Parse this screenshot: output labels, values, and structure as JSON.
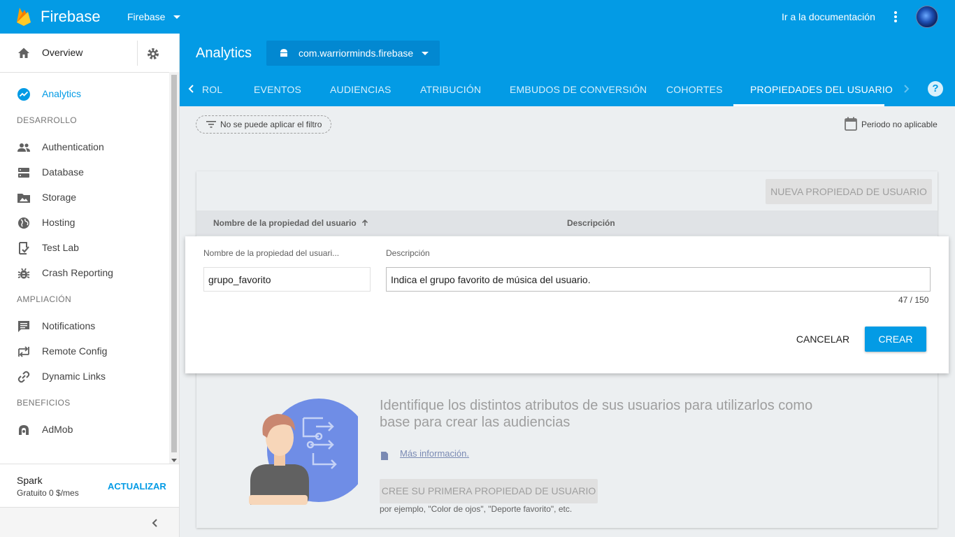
{
  "topbar": {
    "brand": "Firebase",
    "project": "Firebase",
    "docs_link": "Ir a la documentación"
  },
  "sidebar": {
    "overview": "Overview",
    "active_item": "Analytics",
    "sections": {
      "development": "DESARROLLO",
      "growth": "AMPLIACIÓN",
      "earn": "BENEFICIOS"
    },
    "items": {
      "analytics": "Analytics",
      "authentication": "Authentication",
      "database": "Database",
      "storage": "Storage",
      "hosting": "Hosting",
      "test_lab": "Test Lab",
      "crash_reporting": "Crash Reporting",
      "notifications": "Notifications",
      "remote_config": "Remote Config",
      "dynamic_links": "Dynamic Links",
      "admob": "AdMob"
    },
    "plan": {
      "name": "Spark",
      "price": "Gratuito 0 $/mes",
      "upgrade": "ACTUALIZAR"
    }
  },
  "header": {
    "title": "Analytics",
    "app": "com.warriorminds.firebase",
    "tabs": [
      "ROL",
      "EVENTOS",
      "AUDIENCIAS",
      "ATRIBUCIÓN",
      "EMBUDOS DE CONVERSIÓN",
      "COHORTES",
      "PROPIEDADES DEL USUARIO"
    ],
    "active_tab": "PROPIEDADES DEL USUARIO",
    "help": "?"
  },
  "filter": {
    "chip": "No se puede aplicar el filtro",
    "period": "Periodo no aplicable"
  },
  "table": {
    "new_button": "NUEVA PROPIEDAD DE USUARIO",
    "col_name": "Nombre de la propiedad del usuario",
    "col_desc": "Descripción"
  },
  "form": {
    "name_label": "Nombre de la propiedad del usuari...",
    "name_value": "grupo_favorito",
    "desc_label": "Descripción",
    "desc_value": "Indica el grupo favorito de música del usuario.",
    "counter": "47 / 150",
    "cancel": "CANCELAR",
    "create": "CREAR"
  },
  "empty_state": {
    "title": "Identifique los distintos atributos de sus usuarios para utilizarlos como base para crear las audiencias",
    "link": "Más información.",
    "button": "CREE SU PRIMERA PROPIEDAD DE USUARIO",
    "hint": "por ejemplo, \"Color de ojos\", \"Deporte favorito\", etc."
  },
  "colors": {
    "brand_blue": "#039be5",
    "chip_blue": "#0288d1",
    "sidebar_active": "#039be5"
  }
}
